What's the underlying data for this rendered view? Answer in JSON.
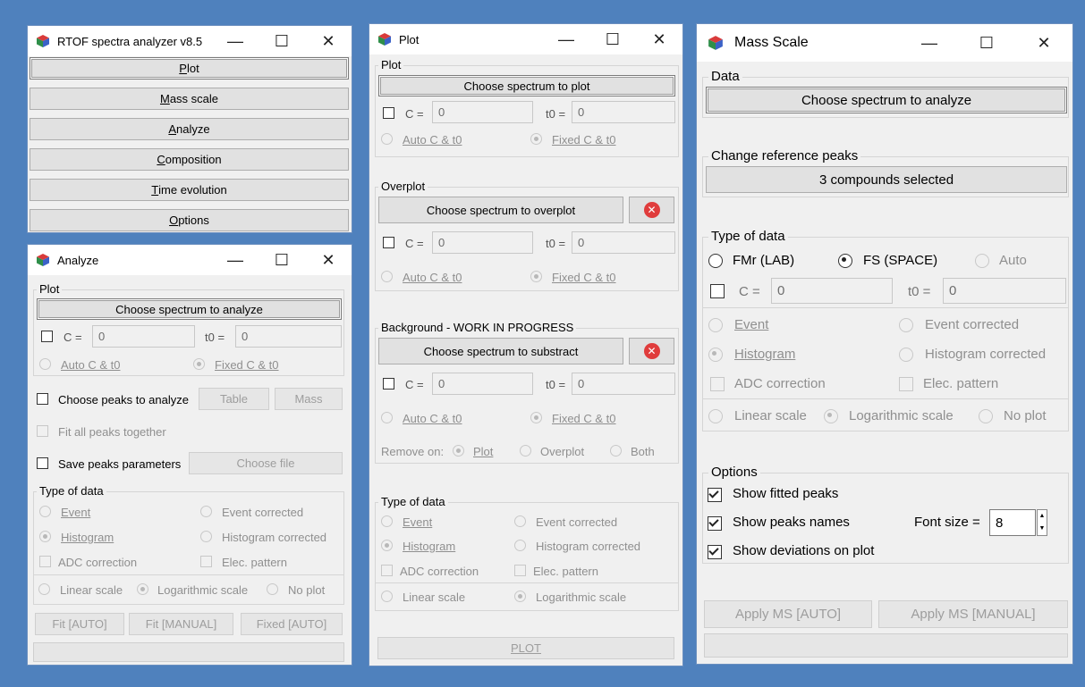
{
  "main": {
    "title": "RTOF spectra analyzer v8.5",
    "buttons": [
      {
        "pre": "",
        "key": "P",
        "post": "lot"
      },
      {
        "pre": "",
        "key": "M",
        "post": "ass scale"
      },
      {
        "pre": "",
        "key": "A",
        "post": "nalyze"
      },
      {
        "pre": "",
        "key": "C",
        "post": "omposition"
      },
      {
        "pre": "",
        "key": "T",
        "post": "ime evolution"
      },
      {
        "pre": "",
        "key": "O",
        "post": "ptions"
      }
    ]
  },
  "analyze": {
    "title": "Analyze",
    "plot_group": "Plot",
    "choose": "Choose spectrum to analyze",
    "c_label": "C =",
    "c_value": "0",
    "t0_label": "t0 =",
    "t0_value": "0",
    "auto_label": "Auto C & t0",
    "fixed_label": "Fixed C & t0",
    "choose_peaks": "Choose peaks to analyze",
    "table": "Table",
    "mass": "Mass",
    "fit_all": "Fit all peaks together",
    "save_params": "Save peaks parameters",
    "choose_file": "Choose file",
    "type_group": "Type of data",
    "event": "Event",
    "event_corrected": "Event corrected",
    "histogram": "Histogram",
    "histogram_corrected": "Histogram corrected",
    "adc": "ADC correction",
    "elec": "Elec. pattern",
    "linear": "Linear scale",
    "log": "Logarithmic scale",
    "noplot": "No plot",
    "fit_auto": "Fit [AUTO]",
    "fit_manual": "Fit [MANUAL]",
    "fixed_auto": "Fixed [AUTO]"
  },
  "plot": {
    "title": "Plot",
    "plot_group": "Plot",
    "choose_plot": "Choose spectrum to plot",
    "c_label": "C =",
    "c_value": "0",
    "t0_label": "t0 =",
    "t0_value": "0",
    "auto_label": "Auto C & t0",
    "fixed_label": "Fixed C & t0",
    "overplot_group": "Overplot",
    "choose_overplot": "Choose spectrum to overplot",
    "background_group": "Background - WORK IN PROGRESS",
    "choose_substract": "Choose spectrum to substract",
    "remove_on": "Remove on:",
    "remove_plot": "Plot",
    "remove_overplot": "Overplot",
    "remove_both": "Both",
    "type_group": "Type of data",
    "event": "Event",
    "event_corrected": "Event corrected",
    "histogram": "Histogram",
    "histogram_corrected": "Histogram corrected",
    "adc": "ADC correction",
    "elec": "Elec. pattern",
    "linear": "Linear scale",
    "log": "Logarithmic scale",
    "plot_button": "PLOT"
  },
  "mass": {
    "title": "Mass Scale",
    "data_group": "Data",
    "choose": "Choose spectrum to analyze",
    "ref_group": "Change reference peaks",
    "compounds": "3 compounds selected",
    "type_group": "Type of data",
    "fmr": "FMr (LAB)",
    "fs": "FS (SPACE)",
    "auto": "Auto",
    "c_label": "C =",
    "c_value": "0",
    "t0_label": "t0 =",
    "t0_value": "0",
    "event": "Event",
    "event_corrected": "Event corrected",
    "histogram": "Histogram",
    "histogram_corrected": "Histogram corrected",
    "adc": "ADC correction",
    "elec": "Elec. pattern",
    "linear": "Linear scale",
    "log": "Logarithmic scale",
    "noplot": "No plot",
    "options_group": "Options",
    "show_fitted": "Show fitted peaks",
    "show_names": "Show peaks names",
    "font_size_label": "Font size =",
    "font_size_value": "8",
    "show_dev": "Show deviations on plot",
    "apply_auto": "Apply MS [AUTO]",
    "apply_manual": "Apply MS [MANUAL]"
  },
  "colors": {
    "desktop": "#4f81bd",
    "window": "#f0f0f0",
    "titlebar": "#ffffff"
  },
  "icons": {
    "app": "cube-icon",
    "minimize": "minimize-icon",
    "maximize": "maximize-icon",
    "close": "close-icon",
    "remove": "red-x-icon"
  }
}
